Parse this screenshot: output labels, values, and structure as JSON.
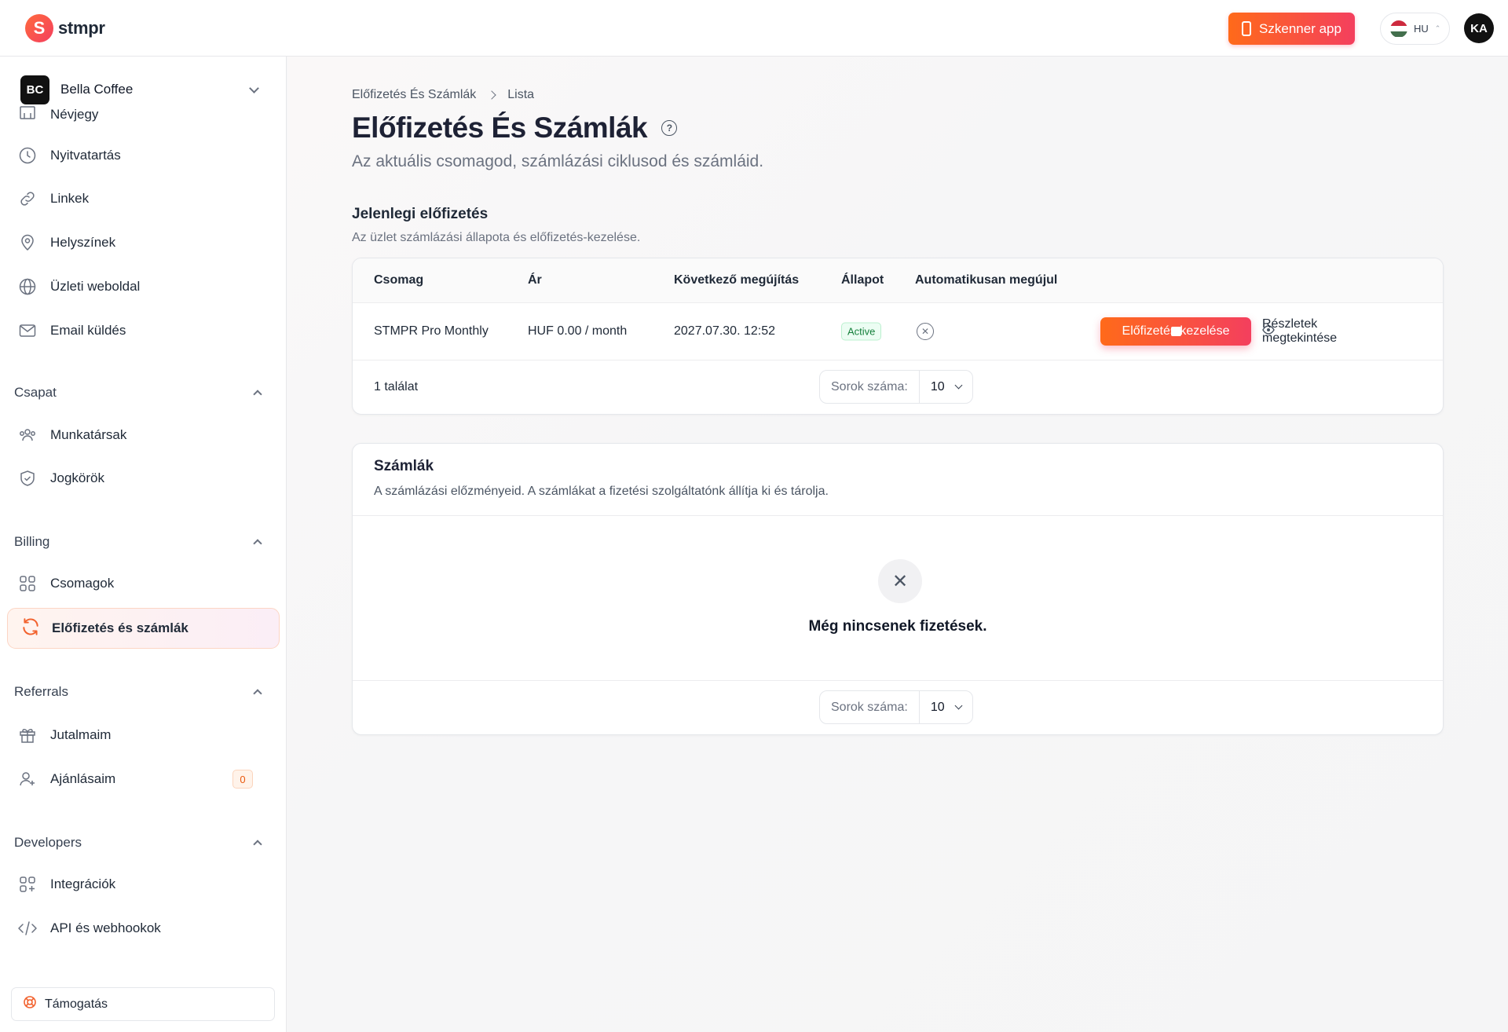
{
  "topbar": {
    "logo_text": "stmpr",
    "scanner_label": "Szkenner app",
    "lang_code": "HU",
    "user_initials": "KA"
  },
  "sidebar": {
    "business": {
      "initials": "BC",
      "name": "Bella Coffee"
    },
    "items_top": [
      {
        "label": "Névjegy",
        "icon": "id-card-icon"
      },
      {
        "label": "Nyitvatartás",
        "icon": "clock-icon"
      },
      {
        "label": "Linkek",
        "icon": "link-icon"
      },
      {
        "label": "Helyszínek",
        "icon": "map-pin-icon"
      },
      {
        "label": "Üzleti weboldal",
        "icon": "globe-icon"
      },
      {
        "label": "Email küldés",
        "icon": "mail-icon"
      }
    ],
    "sections": {
      "team": {
        "title": "Csapat",
        "items": [
          "Munkatársak",
          "Jogkörök"
        ]
      },
      "billing": {
        "title": "Billing",
        "items": [
          "Csomagok",
          "Előfizetés és számlák"
        ]
      },
      "referrals": {
        "title": "Referrals",
        "items": [
          "Jutalmaim",
          "Ajánlásaim"
        ],
        "referral_count": "0"
      },
      "developers": {
        "title": "Developers",
        "items": [
          "Integrációk",
          "API és webhookok"
        ]
      }
    },
    "support_label": "Támogatás"
  },
  "main": {
    "breadcrumb": [
      "Előfizetés És Számlák",
      "Lista"
    ],
    "title": "Előfizetés És Számlák",
    "subtitle": "Az aktuális csomagod, számlázási ciklusod és számláid.",
    "subscription": {
      "title": "Jelenlegi előfizetés",
      "subtitle": "Az üzlet számlázási állapota és előfizetés-kezelése.",
      "columns": [
        "Csomag",
        "Ár",
        "Következő megújítás",
        "Állapot",
        "Automatikusan megújul"
      ],
      "row": {
        "plan": "STMPR Pro Monthly",
        "price": "HUF 0.00 / month",
        "next_renewal": "2027.07.30. 12:52",
        "status": "Active",
        "auto_renew": false
      },
      "manage_label": "Előfizetés kezelése",
      "details_label": "Részletek megtekintése",
      "result_count": "1 találat",
      "rows_label": "Sorok száma:",
      "rows_value": "10"
    },
    "invoices": {
      "title": "Számlák",
      "subtitle": "A számlázási előzményeid. A számlákat a fizetési szolgáltatónk állítja ki és tárolja.",
      "empty_text": "Még nincsenek fizetések.",
      "rows_label": "Sorok száma:",
      "rows_value": "10"
    }
  },
  "colors": {
    "accent_start": "#ff6a1a",
    "accent_end": "#f43f5e",
    "status_green": "#16803c"
  }
}
